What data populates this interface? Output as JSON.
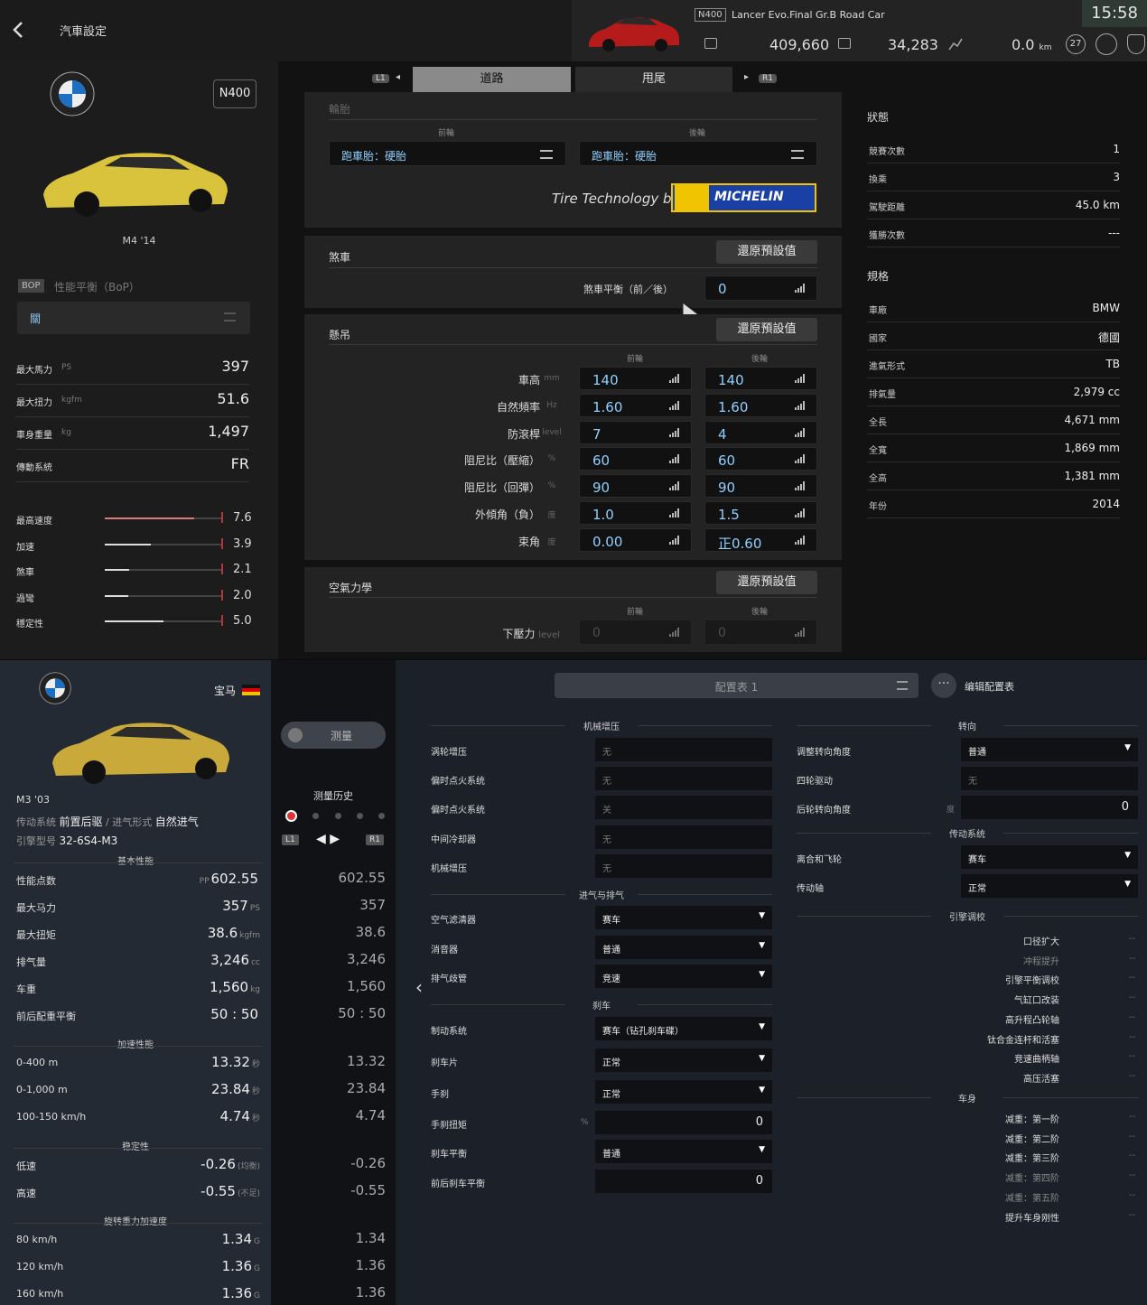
{
  "top": {
    "header": {
      "back_label": "<",
      "title": "汽車設定",
      "car_tag": "N400",
      "car_name": "Lancer Evo.Final Gr.B Road Car",
      "credits": "409,660",
      "mileage_points": "34,283",
      "distance": "0.0",
      "distance_unit": "km",
      "time": "15:58",
      "level": "27"
    },
    "left": {
      "class_badge": "N400",
      "car_model": "M4 '14",
      "bop_tag": "BOP",
      "bop_label": "性能平衡（BoP）",
      "bop_value": "關",
      "specs": [
        {
          "label": "最大馬力",
          "unit": "PS",
          "value": "397"
        },
        {
          "label": "最大扭力",
          "unit": "kgfm",
          "value": "51.6"
        },
        {
          "label": "車身重量",
          "unit": "kg",
          "value": "1,497"
        },
        {
          "label": "傳動系統",
          "unit": "",
          "value": "FR"
        }
      ],
      "ratings": [
        {
          "label": "最高速度",
          "value": "7.6",
          "fill": 0.76
        },
        {
          "label": "加速",
          "value": "3.9",
          "fill": 0.39
        },
        {
          "label": "煞車",
          "value": "2.1",
          "fill": 0.21
        },
        {
          "label": "過彎",
          "value": "2.0",
          "fill": 0.2
        },
        {
          "label": "穩定性",
          "value": "5.0",
          "fill": 0.5
        }
      ]
    },
    "tabs": {
      "l1": "L1",
      "r1": "R1",
      "items": [
        "道路",
        "甩尾"
      ]
    },
    "tires": {
      "section": "輪胎",
      "front_label": "前輪",
      "rear_label": "後輪",
      "front": "跑車胎：硬胎",
      "rear": "跑車胎：硬胎",
      "tech_text": "Tire Technology by",
      "brand": "MICHELIN"
    },
    "brake": {
      "section": "煞車",
      "reset": "還原預設值",
      "balance_label": "煞車平衡（前／後）",
      "balance_value": "0"
    },
    "suspension": {
      "section": "懸吊",
      "reset": "還原預設值",
      "front_label": "前輪",
      "rear_label": "後輪",
      "rows": [
        {
          "label": "車高",
          "unit": "mm",
          "front": "140",
          "rear": "140"
        },
        {
          "label": "自然頻率",
          "unit": "Hz",
          "front": "1.60",
          "rear": "1.60"
        },
        {
          "label": "防滾桿",
          "unit": "level",
          "front": "7",
          "rear": "4"
        },
        {
          "label": "阻尼比（壓縮）",
          "unit": "%",
          "front": "60",
          "rear": "60"
        },
        {
          "label": "阻尼比（回彈）",
          "unit": "%",
          "front": "90",
          "rear": "90"
        },
        {
          "label": "外傾角（負）",
          "unit": "度",
          "front": "1.0",
          "rear": "1.5"
        },
        {
          "label": "束角",
          "unit": "度",
          "front": "0.00",
          "rear": "正0.60"
        }
      ]
    },
    "aero": {
      "section": "空氣力學",
      "reset": "還原預設值",
      "front_label": "前輪",
      "rear_label": "後輪",
      "downforce_label": "下壓力",
      "unit": "level",
      "front": "0",
      "rear": "0"
    },
    "status": {
      "section": "狀態",
      "rows": [
        {
          "label": "競賽次數",
          "value": "1"
        },
        {
          "label": "換乘",
          "value": "3"
        },
        {
          "label": "駕駛距離",
          "value": "45.0 km"
        },
        {
          "label": "獲勝次數",
          "value": "---"
        }
      ]
    },
    "spec": {
      "section": "規格",
      "rows": [
        {
          "label": "車廠",
          "value": "BMW"
        },
        {
          "label": "國家",
          "value": "德國"
        },
        {
          "label": "進氣形式",
          "value": "TB"
        },
        {
          "label": "排氣量",
          "value": "2,979 cc"
        },
        {
          "label": "全長",
          "value": "4,671 mm"
        },
        {
          "label": "全寬",
          "value": "1,869 mm"
        },
        {
          "label": "全高",
          "value": "1,381 mm"
        },
        {
          "label": "年份",
          "value": "2014"
        }
      ]
    }
  },
  "bottom": {
    "left": {
      "maker": "宝马",
      "model": "M3 '03",
      "drive_label": "传动系统",
      "drive_value": "前置后驱",
      "intake_label": "进气形式",
      "intake_value": "自然进气",
      "engine_label": "引擎型号",
      "engine_value": "32-6S4-M3",
      "groups": [
        {
          "title": "基本性能",
          "rows": [
            {
              "label": "性能点数",
              "pre": "PP",
              "value": "602.55",
              "unit": "",
              "hist": "602.55"
            },
            {
              "label": "最大马力",
              "pre": "",
              "value": "357",
              "unit": "PS",
              "hist": "357"
            },
            {
              "label": "最大扭矩",
              "pre": "",
              "value": "38.6",
              "unit": "kgfm",
              "hist": "38.6"
            },
            {
              "label": "排气量",
              "pre": "",
              "value": "3,246",
              "unit": "cc",
              "hist": "3,246"
            },
            {
              "label": "车重",
              "pre": "",
              "value": "1,560",
              "unit": "kg",
              "hist": "1,560"
            },
            {
              "label": "前后配重平衡",
              "pre": "",
              "value": "50 : 50",
              "unit": "",
              "hist": "50 : 50"
            }
          ]
        },
        {
          "title": "加速性能",
          "rows": [
            {
              "label": "0-400 m",
              "pre": "",
              "value": "13.32",
              "unit": "秒",
              "hist": "13.32"
            },
            {
              "label": "0-1,000 m",
              "pre": "",
              "value": "23.84",
              "unit": "秒",
              "hist": "23.84"
            },
            {
              "label": "100-150 km/h",
              "pre": "",
              "value": "4.74",
              "unit": "秒",
              "hist": "4.74"
            }
          ]
        },
        {
          "title": "稳定性",
          "rows": [
            {
              "label": "低速",
              "pre": "",
              "value": "-0.26",
              "unit": "(均衡)",
              "hist": "-0.26"
            },
            {
              "label": "高速",
              "pre": "",
              "value": "-0.55",
              "unit": "(不足)",
              "hist": "-0.55"
            }
          ]
        },
        {
          "title": "旋转重力加速度",
          "rows": [
            {
              "label": "80 km/h",
              "pre": "",
              "value": "1.34",
              "unit": "G",
              "hist": "1.34"
            },
            {
              "label": "120 km/h",
              "pre": "",
              "value": "1.36",
              "unit": "G",
              "hist": "1.36"
            },
            {
              "label": "160 km/h",
              "pre": "",
              "value": "1.36",
              "unit": "G",
              "hist": "1.36"
            }
          ]
        }
      ]
    },
    "measure": {
      "button": "测量",
      "history_label": "测量历史",
      "l1": "L1",
      "r1": "R1"
    },
    "config": {
      "selector": "配置表 1",
      "edit": "编辑配置表"
    },
    "col1": {
      "sections": [
        {
          "title": "机械增压",
          "rows": [
            {
              "label": "涡轮增压",
              "value": "无",
              "type": "text"
            },
            {
              "label": "偏时点火系统",
              "value": "无",
              "type": "text"
            },
            {
              "label": "偏时点火系统",
              "value": "关",
              "type": "text"
            },
            {
              "label": "中间冷却器",
              "value": "无",
              "type": "text"
            },
            {
              "label": "机械增压",
              "value": "无",
              "type": "text"
            }
          ]
        },
        {
          "title": "进气与排气",
          "rows": [
            {
              "label": "空气滤清器",
              "value": "赛车",
              "type": "dd"
            },
            {
              "label": "消音器",
              "value": "普通",
              "type": "dd"
            },
            {
              "label": "排气歧管",
              "value": "竞速",
              "type": "dd"
            }
          ]
        },
        {
          "title": "刹车",
          "rows": [
            {
              "label": "制动系统",
              "value": "赛车（钻孔刹车碟）",
              "type": "dd"
            },
            {
              "label": "刹车片",
              "value": "正常",
              "type": "dd"
            },
            {
              "label": "手刹",
              "value": "正常",
              "type": "dd"
            },
            {
              "label": "手刹扭矩",
              "unit": "%",
              "value": "0",
              "type": "num"
            },
            {
              "label": "刹车平衡",
              "value": "普通",
              "type": "dd"
            },
            {
              "label": "前后刹车平衡",
              "value": "0",
              "type": "num"
            }
          ]
        }
      ]
    },
    "col2": {
      "steer_title": "转向",
      "steer": [
        {
          "label": "调整转向角度",
          "value": "普通",
          "type": "dd"
        },
        {
          "label": "四轮驱动",
          "value": "无",
          "type": "text"
        },
        {
          "label": "后轮转向角度",
          "unit": "度",
          "value": "0",
          "type": "num"
        }
      ],
      "drive_title": "传动系统",
      "drive": [
        {
          "label": "离合和飞轮",
          "value": "赛车",
          "type": "dd"
        },
        {
          "label": "传动轴",
          "value": "正常",
          "type": "dd"
        }
      ],
      "engine_title": "引擎调校",
      "engine": [
        "口径扩大",
        "冲程提升",
        "引擎平衡调校",
        "气缸口改装",
        "高升程凸轮轴",
        "钛合金连杆和活塞",
        "竞速曲柄轴",
        "高压活塞"
      ],
      "body_title": "车身",
      "body": [
        "减重：第一阶",
        "减重：第二阶",
        "减重：第三阶",
        "减重：第四阶",
        "减重：第五阶",
        "提升车身刚性"
      ],
      "dash": "--"
    }
  }
}
